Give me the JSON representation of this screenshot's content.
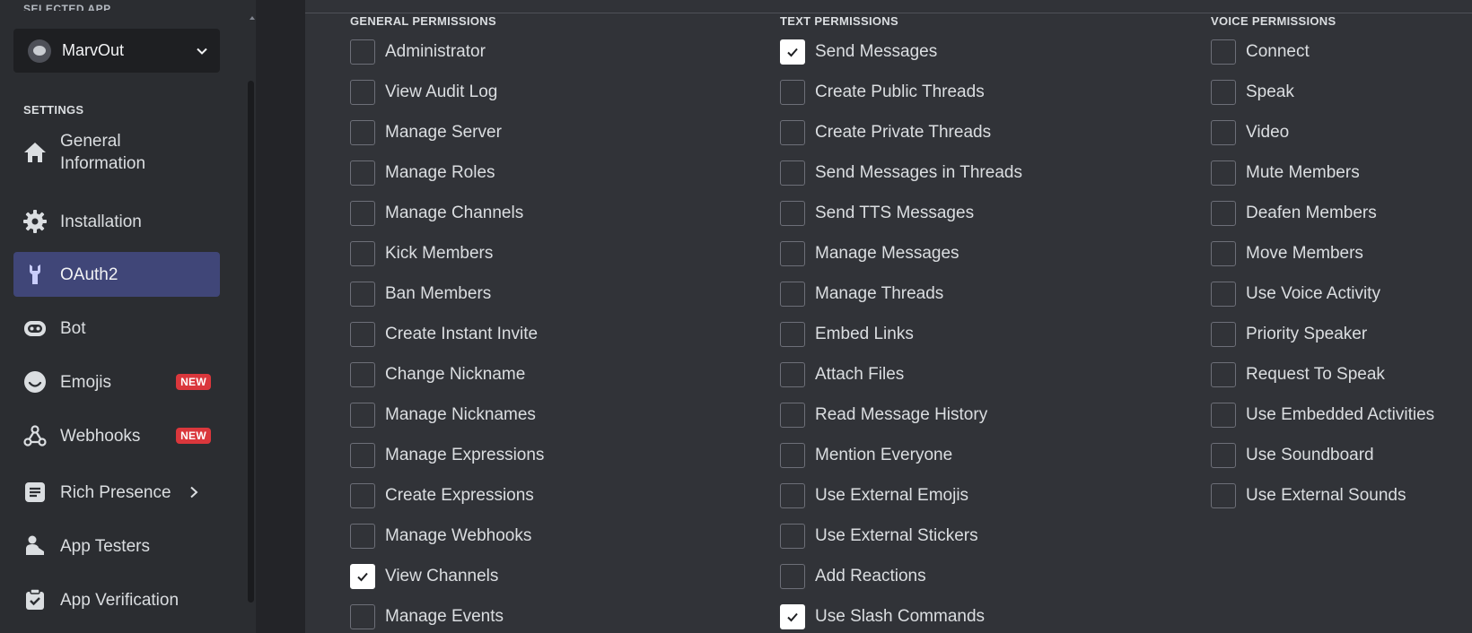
{
  "sidebar": {
    "cut_label": "SELECTED APP",
    "selected_app": "MarvOut",
    "section_label": "SETTINGS",
    "items": [
      {
        "label": "General Information",
        "icon": "home-icon",
        "active": false
      },
      {
        "label": "Installation",
        "icon": "gear-icon",
        "active": false
      },
      {
        "label": "OAuth2",
        "icon": "wrench-icon",
        "active": true
      },
      {
        "label": "Bot",
        "icon": "robot-icon",
        "active": false
      },
      {
        "label": "Emojis",
        "icon": "smile-icon",
        "active": false,
        "badge": "NEW"
      },
      {
        "label": "Webhooks",
        "icon": "webhook-icon",
        "active": false,
        "badge": "NEW"
      },
      {
        "label": "Rich Presence",
        "icon": "document-icon",
        "active": false,
        "has_submenu": true
      },
      {
        "label": "App Testers",
        "icon": "user-icon",
        "active": false
      },
      {
        "label": "App Verification",
        "icon": "clipboard-check-icon",
        "active": false
      }
    ]
  },
  "permissions": {
    "general": {
      "title": "GENERAL PERMISSIONS",
      "items": [
        {
          "label": "Administrator",
          "checked": false
        },
        {
          "label": "View Audit Log",
          "checked": false
        },
        {
          "label": "Manage Server",
          "checked": false
        },
        {
          "label": "Manage Roles",
          "checked": false
        },
        {
          "label": "Manage Channels",
          "checked": false
        },
        {
          "label": "Kick Members",
          "checked": false
        },
        {
          "label": "Ban Members",
          "checked": false
        },
        {
          "label": "Create Instant Invite",
          "checked": false
        },
        {
          "label": "Change Nickname",
          "checked": false
        },
        {
          "label": "Manage Nicknames",
          "checked": false
        },
        {
          "label": "Manage Expressions",
          "checked": false
        },
        {
          "label": "Create Expressions",
          "checked": false
        },
        {
          "label": "Manage Webhooks",
          "checked": false
        },
        {
          "label": "View Channels",
          "checked": true
        },
        {
          "label": "Manage Events",
          "checked": false
        }
      ]
    },
    "text": {
      "title": "TEXT PERMISSIONS",
      "items": [
        {
          "label": "Send Messages",
          "checked": true
        },
        {
          "label": "Create Public Threads",
          "checked": false
        },
        {
          "label": "Create Private Threads",
          "checked": false
        },
        {
          "label": "Send Messages in Threads",
          "checked": false
        },
        {
          "label": "Send TTS Messages",
          "checked": false
        },
        {
          "label": "Manage Messages",
          "checked": false
        },
        {
          "label": "Manage Threads",
          "checked": false
        },
        {
          "label": "Embed Links",
          "checked": false
        },
        {
          "label": "Attach Files",
          "checked": false
        },
        {
          "label": "Read Message History",
          "checked": false
        },
        {
          "label": "Mention Everyone",
          "checked": false
        },
        {
          "label": "Use External Emojis",
          "checked": false
        },
        {
          "label": "Use External Stickers",
          "checked": false
        },
        {
          "label": "Add Reactions",
          "checked": false
        },
        {
          "label": "Use Slash Commands",
          "checked": true
        }
      ]
    },
    "voice": {
      "title": "VOICE PERMISSIONS",
      "items": [
        {
          "label": "Connect",
          "checked": false
        },
        {
          "label": "Speak",
          "checked": false
        },
        {
          "label": "Video",
          "checked": false
        },
        {
          "label": "Mute Members",
          "checked": false
        },
        {
          "label": "Deafen Members",
          "checked": false
        },
        {
          "label": "Move Members",
          "checked": false
        },
        {
          "label": "Use Voice Activity",
          "checked": false
        },
        {
          "label": "Priority Speaker",
          "checked": false
        },
        {
          "label": "Request To Speak",
          "checked": false
        },
        {
          "label": "Use Embedded Activities",
          "checked": false
        },
        {
          "label": "Use Soundboard",
          "checked": false
        },
        {
          "label": "Use External Sounds",
          "checked": false
        }
      ]
    }
  },
  "colors": {
    "accent": "#404678",
    "badge": "#da373c",
    "checkbox_checked": "#ffffff"
  }
}
